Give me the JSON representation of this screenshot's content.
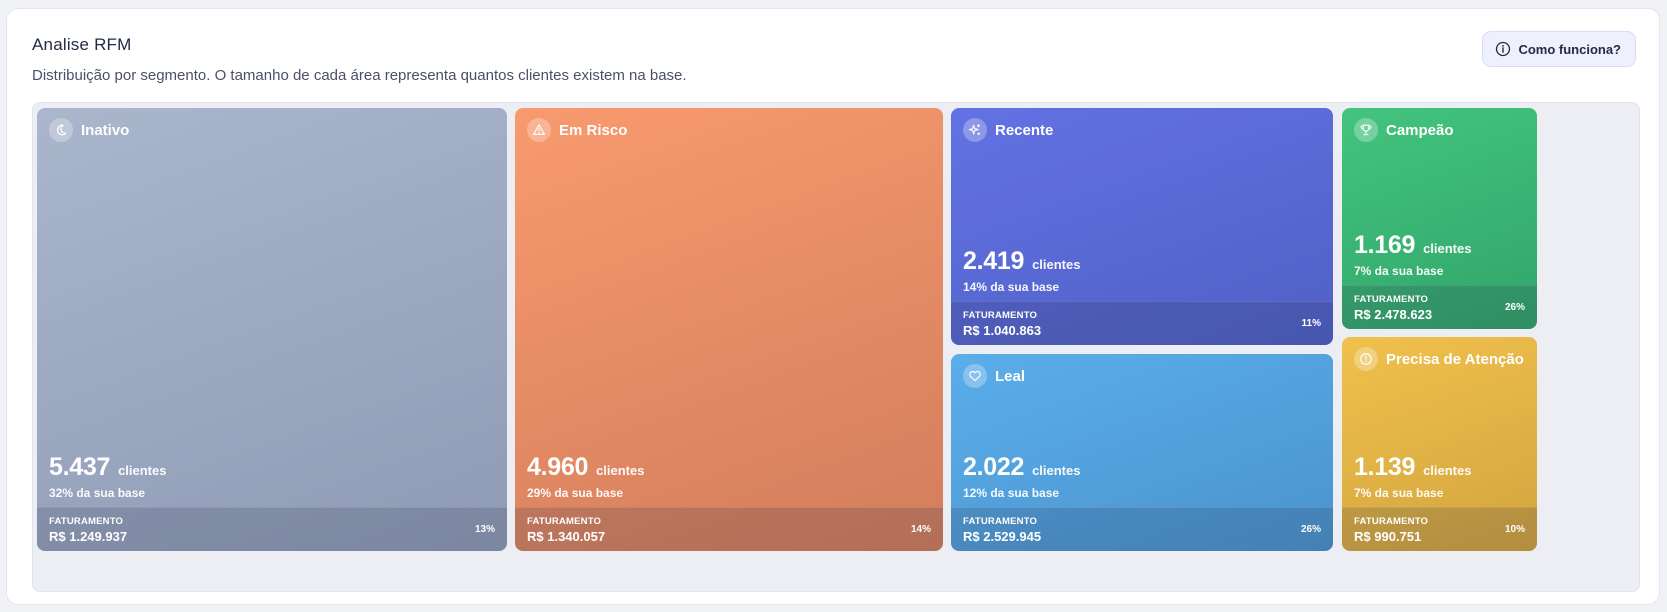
{
  "header": {
    "title": "Analise RFM",
    "subtitle": "Distribuição por segmento. O tamanho de cada área representa quantos clientes existem na base.",
    "help_label": "Como funciona?"
  },
  "labels": {
    "clients_unit": "clientes",
    "revenue_label": "FATURAMENTO"
  },
  "segments": {
    "inativo": {
      "name": "Inativo",
      "icon": "moon-icon",
      "count": "5.437",
      "share": "32% da sua base",
      "revenue": "R$ 1.249.937",
      "revenue_pct": "13%",
      "color_from": "#aab6cc",
      "color_to": "#8f9bb5"
    },
    "em_risco": {
      "name": "Em Risco",
      "icon": "warning-icon",
      "count": "4.960",
      "share": "29% da sua base",
      "revenue": "R$ 1.340.057",
      "revenue_pct": "14%",
      "color_from": "#f89a6e",
      "color_to": "#d27d5c"
    },
    "recente": {
      "name": "Recente",
      "icon": "sparkles-icon",
      "count": "2.419",
      "share": "14% da sua base",
      "revenue": "R$ 1.040.863",
      "revenue_pct": "11%",
      "color_from": "#6372e3",
      "color_to": "#4f60c6"
    },
    "campeao": {
      "name": "Campeão",
      "icon": "trophy-icon",
      "count": "1.169",
      "share": "7% da sua base",
      "revenue": "R$ 2.478.623",
      "revenue_pct": "26%",
      "color_from": "#43c47e",
      "color_to": "#31a56a"
    },
    "leal": {
      "name": "Leal",
      "icon": "heart-icon",
      "count": "2.022",
      "share": "12% da sua base",
      "revenue": "R$ 2.529.945",
      "revenue_pct": "26%",
      "color_from": "#5aaeea",
      "color_to": "#4b93cd"
    },
    "precisa_atencao": {
      "name": "Precisa de Atenção",
      "icon": "alert-circle-icon",
      "count": "1.139",
      "share": "7% da sua base",
      "revenue": "R$ 990.751",
      "revenue_pct": "10%",
      "color_from": "#f0c14d",
      "color_to": "#d2a43e"
    }
  }
}
